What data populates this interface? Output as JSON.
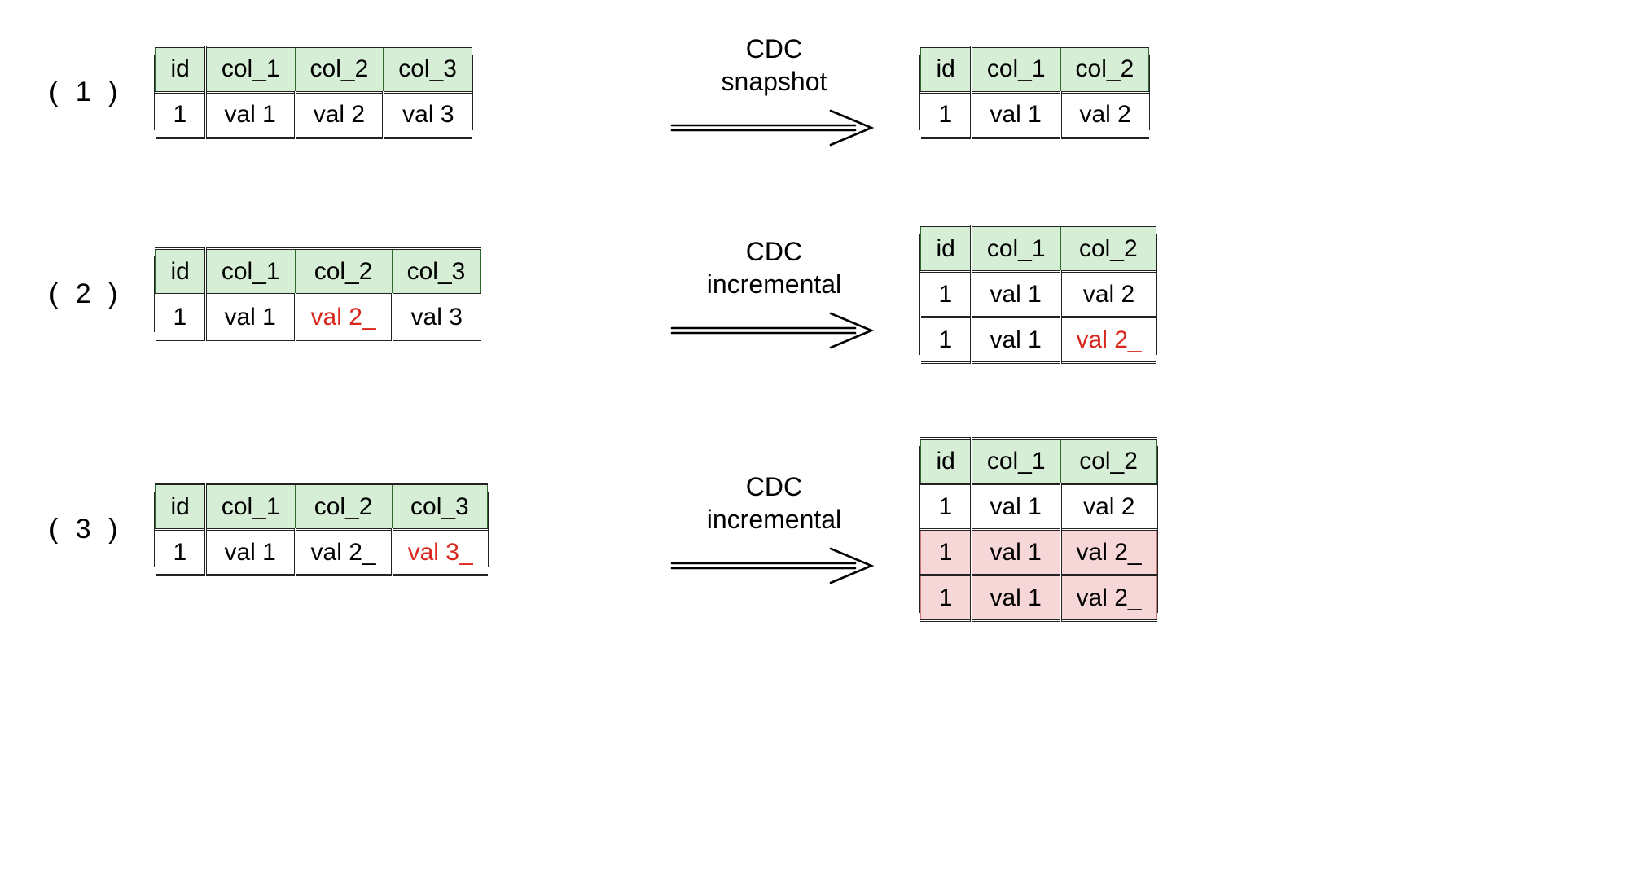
{
  "step1": {
    "num": "( 1 )",
    "arrow_label": "CDC\nsnapshot",
    "src": {
      "headers": [
        "id",
        "col_1",
        "col_2",
        "col_3"
      ],
      "rows": [
        {
          "cells": [
            "1",
            "val 1",
            "val 2",
            "val 3"
          ],
          "red": []
        }
      ]
    },
    "dst": {
      "headers": [
        "id",
        "col_1",
        "col_2"
      ],
      "rows": [
        {
          "cells": [
            "1",
            "val 1",
            "val 2"
          ],
          "red": []
        }
      ]
    }
  },
  "step2": {
    "num": "( 2 )",
    "arrow_label": "CDC\nincremental",
    "src": {
      "headers": [
        "id",
        "col_1",
        "col_2",
        "col_3"
      ],
      "rows": [
        {
          "cells": [
            "1",
            "val 1",
            "val 2_",
            "val 3"
          ],
          "red": [
            2
          ]
        }
      ]
    },
    "dst": {
      "headers": [
        "id",
        "col_1",
        "col_2"
      ],
      "rows": [
        {
          "cells": [
            "1",
            "val 1",
            "val 2"
          ],
          "red": []
        },
        {
          "cells": [
            "1",
            "val 1",
            "val 2_"
          ],
          "red": [
            2
          ]
        }
      ]
    }
  },
  "step3": {
    "num": "( 3 )",
    "arrow_label": "CDC\nincremental",
    "src": {
      "headers": [
        "id",
        "col_1",
        "col_2",
        "col_3"
      ],
      "rows": [
        {
          "cells": [
            "1",
            "val 1",
            "val 2_",
            "val 3_"
          ],
          "red": [
            3
          ]
        }
      ]
    },
    "dst": {
      "headers": [
        "id",
        "col_1",
        "col_2"
      ],
      "rows": [
        {
          "cells": [
            "1",
            "val 1",
            "val 2"
          ],
          "red": []
        },
        {
          "cells": [
            "1",
            "val 1",
            "val 2_"
          ],
          "red": [],
          "dup": true
        },
        {
          "cells": [
            "1",
            "val 1",
            "val 2_"
          ],
          "red": [],
          "dup": true
        }
      ]
    }
  }
}
